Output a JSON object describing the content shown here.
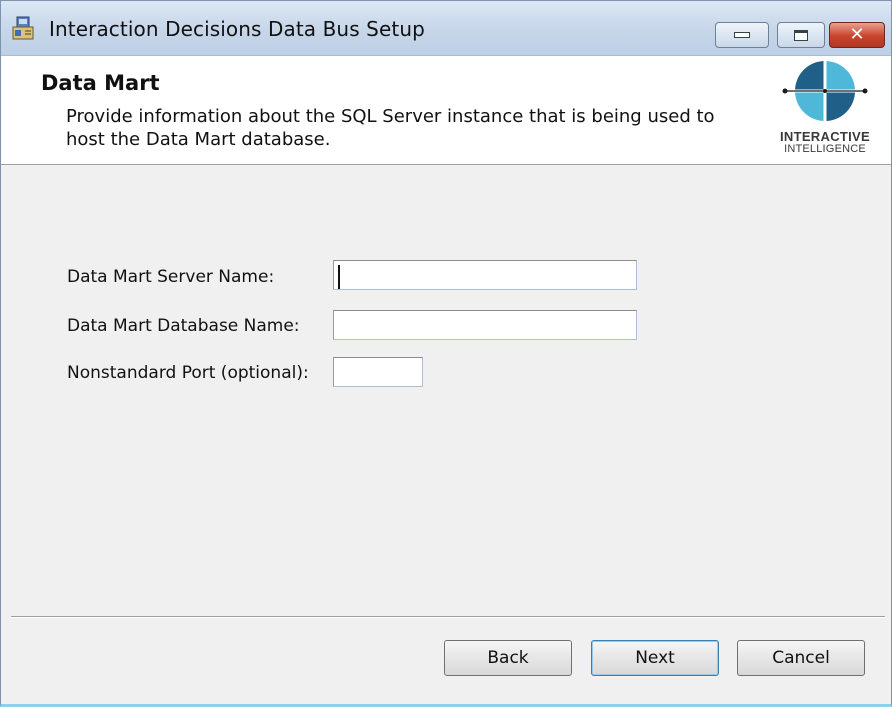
{
  "window": {
    "title": "Interaction Decisions Data Bus Setup",
    "controls": {
      "minimize": "minimize-icon",
      "maximize": "maximize-icon",
      "close": "close-icon"
    }
  },
  "header": {
    "title": "Data Mart",
    "description": "Provide information about the SQL Server instance that is being used to host the Data Mart database.",
    "logo_line1": "INTERACTIVE",
    "logo_line2": "INTELLIGENCE"
  },
  "form": {
    "server_name_label": "Data Mart Server Name:",
    "server_name_value": "",
    "database_name_label": "Data Mart Database Name:",
    "database_name_value": "",
    "port_label": "Nonstandard Port (optional):",
    "port_value": ""
  },
  "buttons": {
    "back": "Back",
    "next": "Next",
    "cancel": "Cancel"
  },
  "colors": {
    "logo_dark": "#1f5f88",
    "logo_light": "#4fb8d8",
    "close_button": "#c8442c",
    "default_button_border": "#3c7fb1"
  }
}
